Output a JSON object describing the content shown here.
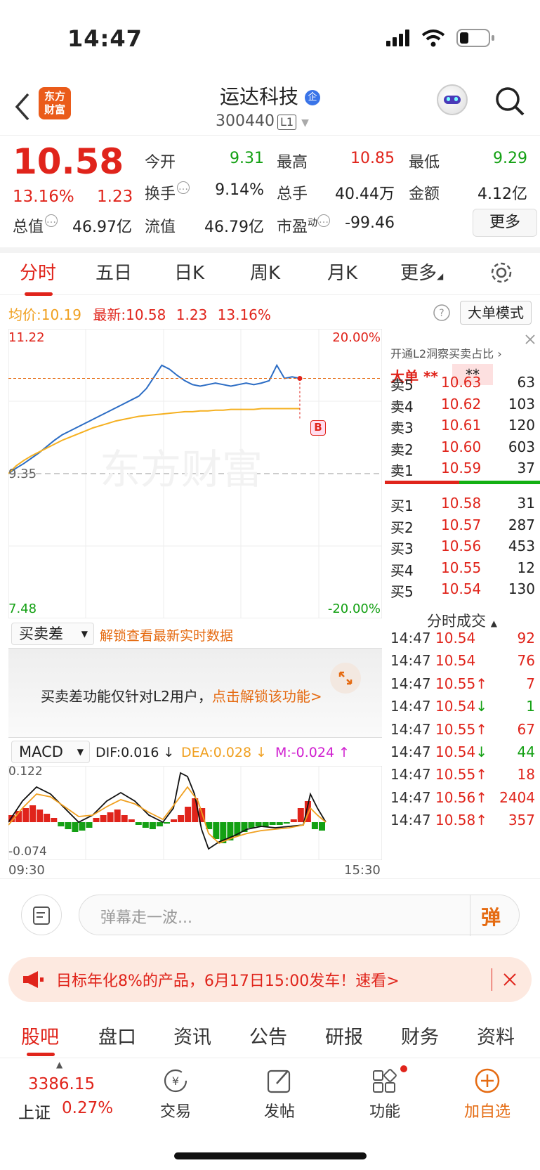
{
  "status_bar": {
    "time": "14:47"
  },
  "header": {
    "logo_line1": "东方",
    "logo_line2": "财富",
    "stock_name": "运达科技",
    "company_badge": "企",
    "stock_code": "300440",
    "level_badge": "L1"
  },
  "quote": {
    "price": "10.58",
    "change_pct": "13.16%",
    "change": "1.23",
    "open_label": "今开",
    "open": "9.31",
    "high_label": "最高",
    "high": "10.85",
    "low_label": "最低",
    "low": "9.29",
    "turnover_label": "换手",
    "turnover": "9.14%",
    "volume_label": "总手",
    "volume": "40.44万",
    "amount_label": "金额",
    "amount": "4.12亿",
    "mktcap_label": "总值",
    "mktcap": "46.97亿",
    "float_label": "流值",
    "float_cap": "46.79亿",
    "pe_label": "市盈",
    "pe_sup": "动",
    "pe": "-99.46",
    "more_label": "更多"
  },
  "period_tabs": [
    "分时",
    "五日",
    "日K",
    "周K",
    "月K",
    "更多"
  ],
  "chart_info": {
    "avg_label": "均价:",
    "avg": "10.19",
    "latest_label": "最新:",
    "latest": "10.58",
    "latest_change": "1.23",
    "latest_pct": "13.16%",
    "big_order_mode": "大单模式",
    "y_max": "11.22",
    "y_prev_close": "9.35",
    "y_min": "7.48",
    "pct_max": "20.00%",
    "pct_min": "-20.00%",
    "watermark": "东方财富",
    "buy_marker": "B"
  },
  "chart_data": {
    "type": "line",
    "ylim": [
      7.48,
      11.22
    ],
    "prev_close": 9.35,
    "series": [
      {
        "values": [
          9.35,
          9.42,
          9.48,
          9.55,
          9.62,
          9.7,
          9.78,
          9.85,
          9.9,
          9.95,
          10.0,
          10.05,
          10.1,
          10.15,
          10.2,
          10.25,
          10.3,
          10.35,
          10.45,
          10.6,
          10.75,
          10.7,
          10.62,
          10.55,
          10.5,
          10.48,
          10.5,
          10.52,
          10.5,
          10.48,
          10.5,
          10.52,
          10.5,
          10.52,
          10.55,
          10.75,
          10.58,
          10.6,
          10.58
        ]
      },
      {
        "values": [
          9.35,
          9.45,
          9.52,
          9.58,
          9.63,
          9.68,
          9.73,
          9.78,
          9.82,
          9.86,
          9.9,
          9.94,
          9.97,
          10.0,
          10.03,
          10.05,
          10.07,
          10.09,
          10.1,
          10.11,
          10.12,
          10.13,
          10.14,
          10.15,
          10.15,
          10.16,
          10.16,
          10.17,
          10.17,
          10.18,
          10.18,
          10.18,
          10.18,
          10.19,
          10.19,
          10.19,
          10.19,
          10.19,
          10.19
        ]
      }
    ]
  },
  "order_book": {
    "l2_tip": "开通L2洞察买卖占比",
    "big_order_label": "大单",
    "stars": "**",
    "sells": [
      {
        "label": "卖5",
        "price": "10.63",
        "vol": "63"
      },
      {
        "label": "卖4",
        "price": "10.62",
        "vol": "103"
      },
      {
        "label": "卖3",
        "price": "10.61",
        "vol": "120"
      },
      {
        "label": "卖2",
        "price": "10.60",
        "vol": "603"
      },
      {
        "label": "卖1",
        "price": "10.59",
        "vol": "37"
      }
    ],
    "buys": [
      {
        "label": "买1",
        "price": "10.58",
        "vol": "31"
      },
      {
        "label": "买2",
        "price": "10.57",
        "vol": "287"
      },
      {
        "label": "买3",
        "price": "10.56",
        "vol": "453"
      },
      {
        "label": "买4",
        "price": "10.55",
        "vol": "12"
      },
      {
        "label": "买5",
        "price": "10.54",
        "vol": "130"
      }
    ],
    "ticks_title": "分时成交",
    "ticks": [
      {
        "time": "14:47",
        "price": "10.54",
        "vol": "92",
        "vcolor": "red"
      },
      {
        "time": "14:47",
        "price": "10.54",
        "vol": "76",
        "vcolor": "red"
      },
      {
        "time": "14:47",
        "price": "10.55↑",
        "vol": "7",
        "vcolor": "red"
      },
      {
        "time": "14:47",
        "price": "10.54↓",
        "vol": "1",
        "vcolor": "green"
      },
      {
        "time": "14:47",
        "price": "10.55↑",
        "vol": "67",
        "vcolor": "red"
      },
      {
        "time": "14:47",
        "price": "10.54↓",
        "vol": "44",
        "vcolor": "green"
      },
      {
        "time": "14:47",
        "price": "10.55↑",
        "vol": "18",
        "vcolor": "red"
      },
      {
        "time": "14:47",
        "price": "10.56↑",
        "vol": "2404",
        "vcolor": "red"
      },
      {
        "time": "14:47",
        "price": "10.58↑",
        "vol": "357",
        "vcolor": "red"
      }
    ]
  },
  "mmc": {
    "select": "买卖差",
    "unlock_text": "解锁查看最新实时数据",
    "lock_msg": "买卖差功能仅针对L2用户，",
    "lock_link": "点击解锁该功能>"
  },
  "macd": {
    "select": "MACD",
    "dif": "DIF:0.016 ↓",
    "dea": "DEA:0.028 ↓",
    "m": "M:-0.024 ↑",
    "y_max": "0.122",
    "y_min": "-0.074",
    "x_start": "09:30",
    "x_end": "15:30"
  },
  "comment_input": {
    "placeholder": "弹幕走一波...",
    "danmu": "弹"
  },
  "banner": {
    "text": "目标年化8%的产品，6月17日15:00发车！速看>"
  },
  "section_tabs": [
    "股吧",
    "盘口",
    "资讯",
    "公告",
    "研报",
    "财务",
    "资料"
  ],
  "bottom_nav": {
    "index_value": "3386.15",
    "index_name": "上证",
    "index_pct": "0.27%",
    "items": [
      "交易",
      "发帖",
      "功能",
      "加自选"
    ]
  }
}
